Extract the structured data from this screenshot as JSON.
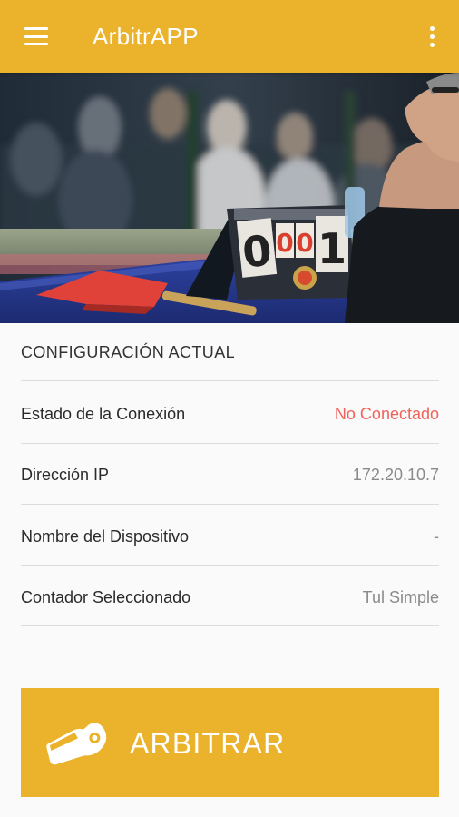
{
  "appbar": {
    "title": "ArbitrAPP",
    "menu_icon": "hamburger-menu-icon",
    "overflow_icon": "more-vertical-icon",
    "color": "#ebb22b"
  },
  "hero": {
    "scoreboard_digits": [
      "0",
      "0",
      "0",
      "1"
    ]
  },
  "config": {
    "section_title": "CONFIGURACIÓN ACTUAL",
    "rows": [
      {
        "label": "Estado de la Conexión",
        "value": "No Conectado",
        "status_color": "#f0625a"
      },
      {
        "label": "Dirección IP",
        "value": "172.20.10.7"
      },
      {
        "label": "Nombre del Dispositivo",
        "value": "-"
      },
      {
        "label": "Contador Seleccionado",
        "value": "Tul Simple"
      }
    ]
  },
  "action": {
    "label": "ARBITRAR",
    "icon": "whistle-icon"
  }
}
